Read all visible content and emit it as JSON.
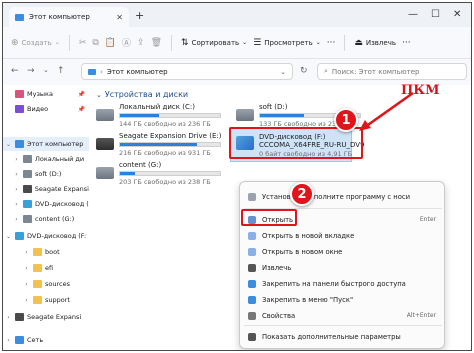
{
  "window": {
    "tab_title": "Этот компьютер",
    "colors": {
      "accent": "#2a82da",
      "annotation": "#e0141b",
      "selection": "#cfe3f7"
    }
  },
  "toolbar": {
    "create_label": "Создать",
    "sort_label": "Сортировать",
    "view_label": "Просмотреть",
    "eject_label": "Извлечь"
  },
  "address": {
    "path": "Этот компьютер",
    "search_placeholder": "Поиск: Этот компьютер"
  },
  "sidebar": {
    "items": [
      {
        "label": "Музыка",
        "icon": "music-icon"
      },
      {
        "label": "Видео",
        "icon": "video-icon"
      },
      {
        "label": "Этот компьютер",
        "icon": "computer-icon"
      },
      {
        "label": "Локальный ди",
        "icon": "drive-icon"
      },
      {
        "label": "soft (D:)",
        "icon": "drive-icon"
      },
      {
        "label": "Seagate Expansi",
        "icon": "drive-icon"
      },
      {
        "label": "DVD-дисковод (",
        "icon": "dvd-icon"
      },
      {
        "label": "content (G:)",
        "icon": "drive-icon"
      },
      {
        "label": "DVD-дисковод (F:",
        "icon": "dvd-icon"
      },
      {
        "label": "boot",
        "icon": "folder-icon"
      },
      {
        "label": "efi",
        "icon": "folder-icon"
      },
      {
        "label": "sources",
        "icon": "folder-icon"
      },
      {
        "label": "support",
        "icon": "folder-icon"
      },
      {
        "label": "Seagate Expansi",
        "icon": "drive-icon"
      },
      {
        "label": "Сеть",
        "icon": "network-icon"
      }
    ]
  },
  "main": {
    "section_title": "Устройства и диски",
    "drives": [
      {
        "name": "Локальный диск (C:)",
        "free": "144 ГБ свободно из 236 ГБ",
        "used_fraction": 0.39
      },
      {
        "name": "soft (D:)",
        "free": "133 ГБ свободно из 237 ГБ",
        "used_fraction": 0.44
      },
      {
        "name": "Seagate Expansion Drive (E:)",
        "free": "216 ГБ свободно из 931 ГБ",
        "used_fraction": 0.77
      },
      {
        "name": "content (G:)",
        "free": "203 ГБ свободно из 238 ГБ",
        "used_fraction": 0.15
      }
    ],
    "dvd": {
      "name": "DVD-дисковод (F:)",
      "label": "CCCOMA_X64FRE_RU-RU_DV9",
      "free": "0 байт свободно из 4,91 ГБ"
    }
  },
  "context_menu": {
    "items": [
      {
        "label": "Установить",
        "suffix": "дополните программу с носи",
        "icon": "install-icon"
      },
      {
        "label": "Открыть",
        "shortcut": "Enter",
        "icon": "open-icon"
      },
      {
        "label": "Открыть в новой вкладке",
        "icon": "new-tab-icon"
      },
      {
        "label": "Открыть в новом окне",
        "icon": "new-window-icon"
      },
      {
        "label": "Извлечь",
        "icon": "eject-icon"
      },
      {
        "label": "Закрепить на панели быстрого доступа",
        "icon": "pin-icon"
      },
      {
        "label": "Закрепить в меню \"Пуск\"",
        "icon": "pin-icon"
      },
      {
        "label": "Свойства",
        "shortcut": "Alt+Enter",
        "icon": "properties-icon"
      },
      {
        "label": "Показать дополнительные параметры",
        "icon": "more-options-icon"
      }
    ]
  },
  "annotations": {
    "pkm": "ПКМ",
    "step1": "1",
    "step2": "2"
  }
}
